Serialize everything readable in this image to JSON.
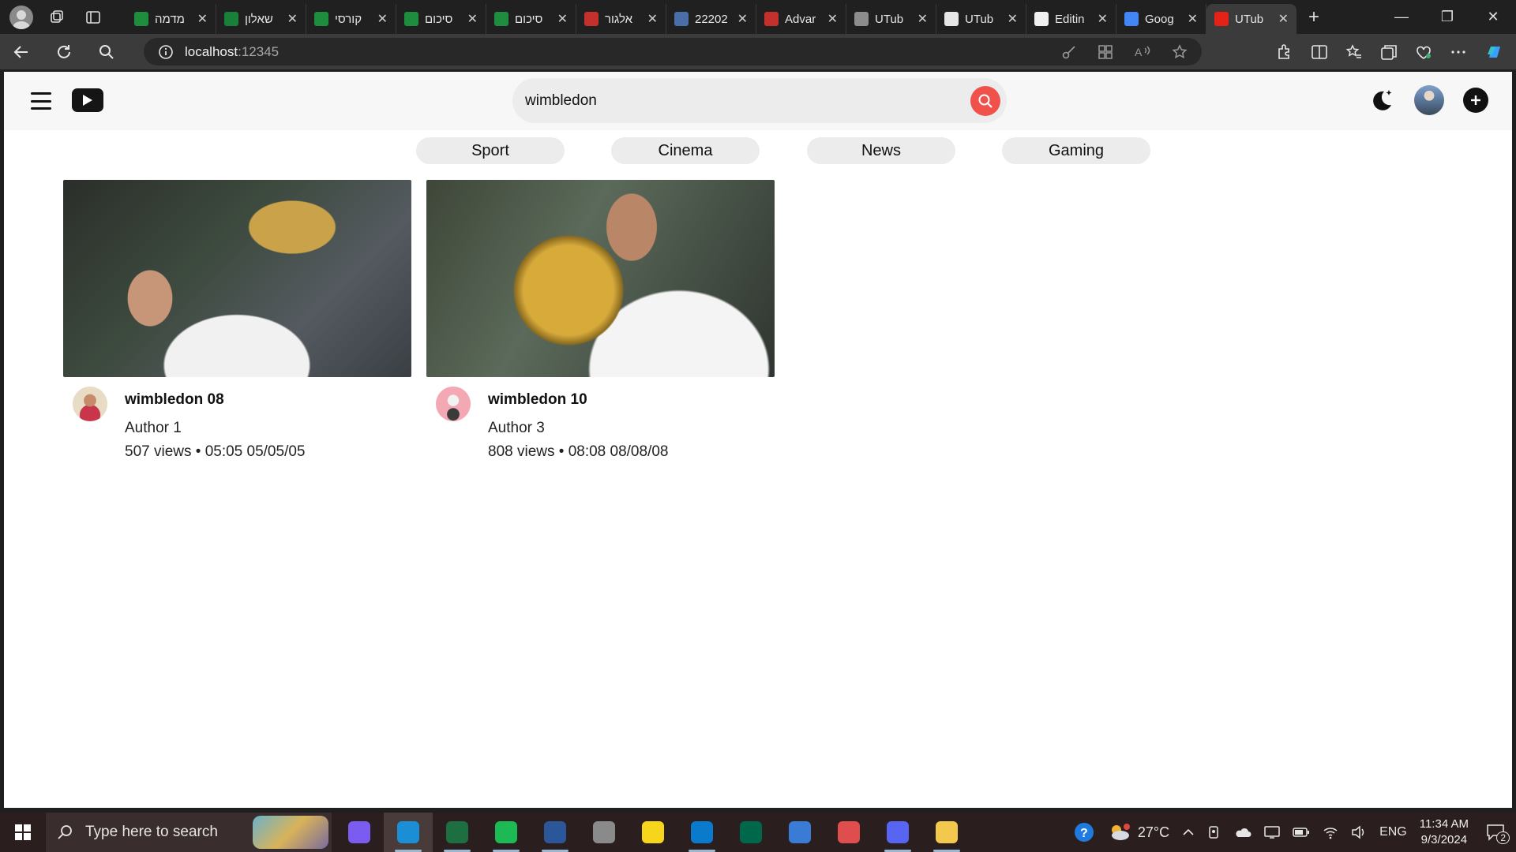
{
  "browser": {
    "tabs": [
      {
        "title": "מדמה",
        "favicon_color": "#1e8e3e"
      },
      {
        "title": "שאלון",
        "favicon_color": "#188038"
      },
      {
        "title": "קורסי",
        "favicon_color": "#1e8e3e"
      },
      {
        "title": "סיכום",
        "favicon_color": "#1e8e3e"
      },
      {
        "title": "סיכום",
        "favicon_color": "#1e8e3e"
      },
      {
        "title": "אלגור",
        "favicon_color": "#c4302b"
      },
      {
        "title": "22202",
        "favicon_color": "#4b6ea8"
      },
      {
        "title": "Advar",
        "favicon_color": "#c4302b"
      },
      {
        "title": "UTub",
        "favicon_color": "#8c8c8c"
      },
      {
        "title": "UTub",
        "favicon_color": "#e6e6e6"
      },
      {
        "title": "Editin",
        "favicon_color": "#f0f0f0"
      },
      {
        "title": "Goog",
        "favicon_color": "#4285f4"
      },
      {
        "title": "UTub",
        "favicon_color": "#e62117"
      }
    ],
    "active_tab_index": 12,
    "url_host": "localhost",
    "url_port": ":12345"
  },
  "app": {
    "search": {
      "value": "wimbledon",
      "placeholder": "Search"
    },
    "categories": [
      "Sport",
      "Cinema",
      "News",
      "Gaming"
    ],
    "videos": [
      {
        "title": "wimbledon 08",
        "author": "Author 1",
        "stats": "507 views • 05:05 05/05/05"
      },
      {
        "title": "wimbledon 10",
        "author": "Author 3",
        "stats": "808 views • 08:08 08/08/08"
      }
    ],
    "colors": {
      "accent": "#f0514b",
      "chip_bg": "#ececec",
      "header_bg": "#f7f7f7"
    }
  },
  "taskbar": {
    "search_placeholder": "Type here to search",
    "weather": "27°C",
    "language": "ENG",
    "time": "11:34 AM",
    "date": "9/3/2024",
    "notification_count": "2",
    "pinned_apps": [
      {
        "name": "copilot",
        "color": "#7a5cf0",
        "running": false
      },
      {
        "name": "edge",
        "color": "#1b8fd6",
        "running": true
      },
      {
        "name": "excel",
        "color": "#1d6f42",
        "running": true
      },
      {
        "name": "spotify",
        "color": "#1db954",
        "running": true
      },
      {
        "name": "word",
        "color": "#2b579a",
        "running": true
      },
      {
        "name": "snipping-tool",
        "color": "#8a8a8a",
        "running": false
      },
      {
        "name": "sticky-notes",
        "color": "#f7d51d",
        "running": false
      },
      {
        "name": "vscode",
        "color": "#0a7acc",
        "running": true
      },
      {
        "name": "mongodb-compass",
        "color": "#00684a",
        "running": false
      },
      {
        "name": "app-store",
        "color": "#3a7bd5",
        "running": false
      },
      {
        "name": "paint",
        "color": "#e04d4d",
        "running": false
      },
      {
        "name": "discord-like",
        "color": "#5865f2",
        "running": true
      },
      {
        "name": "file-explorer",
        "color": "#f2c94c",
        "running": true
      }
    ]
  }
}
